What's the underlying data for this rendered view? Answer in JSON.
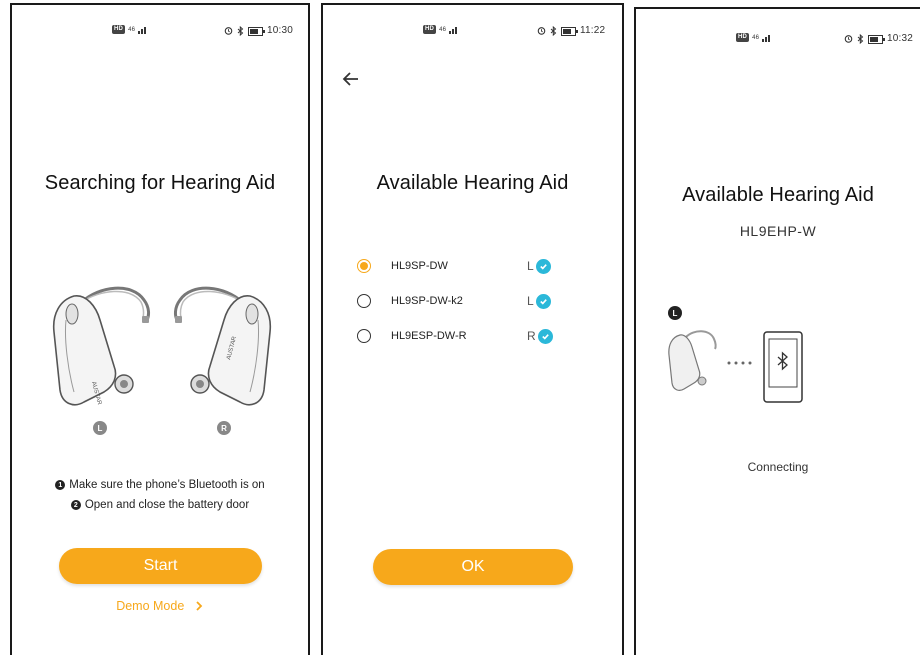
{
  "screens": [
    {
      "status": {
        "network": "46",
        "time": "10:30"
      },
      "title": "Searching for Hearing Aid",
      "left_label": "L",
      "right_label": "R",
      "instructions": [
        {
          "num": "1",
          "text": "Make sure the phone’s Bluetooth is on"
        },
        {
          "num": "2",
          "text": "Open and close the battery door"
        }
      ],
      "start_label": "Start",
      "demo_label": "Demo Mode",
      "device_brand": "AUSTAR"
    },
    {
      "status": {
        "network": "46",
        "time": "11:22"
      },
      "title": "Available Hearing Aid",
      "devices": [
        {
          "name": "HL9SP-DW",
          "side": "L",
          "selected": true
        },
        {
          "name": "HL9SP-DW-k2",
          "side": "L",
          "selected": false
        },
        {
          "name": "HL9ESP-DW-R",
          "side": "R",
          "selected": false
        }
      ],
      "ok_label": "OK"
    },
    {
      "status": {
        "network": "46",
        "time": "10:32"
      },
      "title": "Available Hearing Aid",
      "subtitle": "HL9EHP-W",
      "side_label": "L",
      "connecting_label": "Connecting"
    }
  ],
  "colors": {
    "accent": "#f7a81b",
    "check": "#2bb8d9"
  },
  "icons": [
    "hd-icon",
    "signal-icon",
    "alarm-icon",
    "bluetooth-icon",
    "battery-icon",
    "back-arrow-icon",
    "check-icon",
    "chevron-right-icon",
    "phone-icon",
    "hearing-aid-icon"
  ]
}
